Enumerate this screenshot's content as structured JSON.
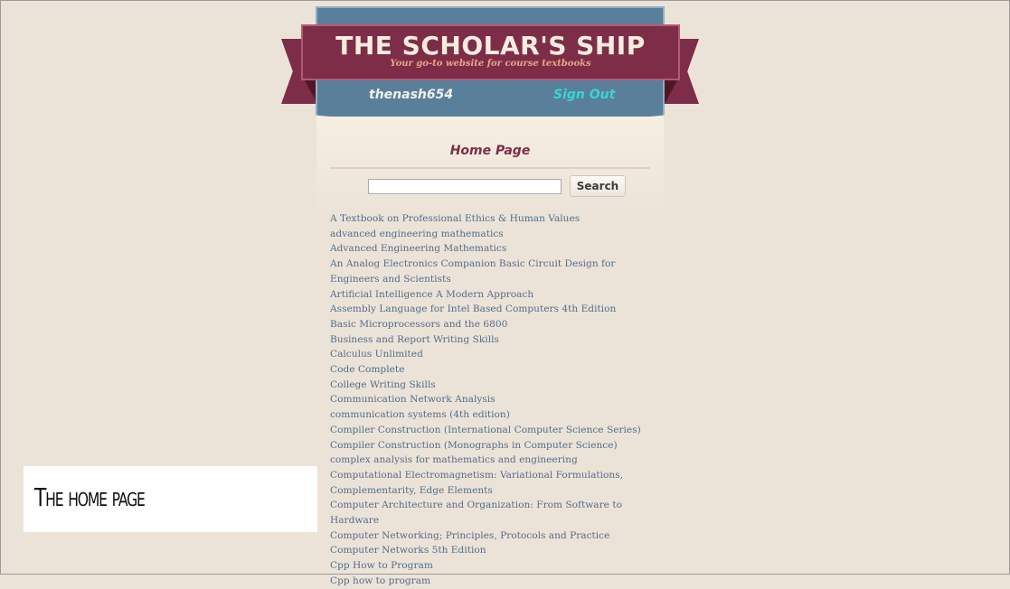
{
  "header": {
    "title": "THE SCHOLAR'S SHIP",
    "tagline": "Your go-to website for course textbooks",
    "username": "thenash654",
    "signout_label": "Sign Out"
  },
  "main": {
    "heading": "Home Page",
    "search": {
      "value": "",
      "placeholder": "",
      "button_label": "Search"
    },
    "books": [
      "A Textbook on Professional Ethics & Human Values",
      "advanced engineering mathematics",
      "Advanced Engineering Mathematics",
      "An Analog Electronics Companion Basic Circuit Design for Engineers and Scientists",
      "Artificial Intelligence A Modern Approach",
      "Assembly Language for Intel Based Computers 4th Edition",
      "Basic Microprocessors and the 6800",
      "Business and Report Writing Skills",
      "Calculus Unlimited",
      "Code Complete",
      "College Writing Skills",
      "Communication Network Analysis",
      "communication systems (4th edition)",
      "Compiler Construction (International Computer Science Series)",
      "Compiler Construction (Monographs in Computer Science)",
      "complex analysis for mathematics and engineering",
      "Computational Electromagnetism: Variational Formulations, Complementarity, Edge Elements",
      "Computer Architecture and Organization: From Software to Hardware",
      "Computer Networking; Principles, Protocols and Practice",
      "Computer Networks 5th Edition",
      "Cpp How to Program",
      "Cpp how to program"
    ]
  },
  "caption": "The home page",
  "colors": {
    "background": "#ece3d8",
    "ribbon": "#7d2d47",
    "banner": "#5a7f9b",
    "link": "#4f6e8b",
    "signout": "#36d6d6"
  }
}
